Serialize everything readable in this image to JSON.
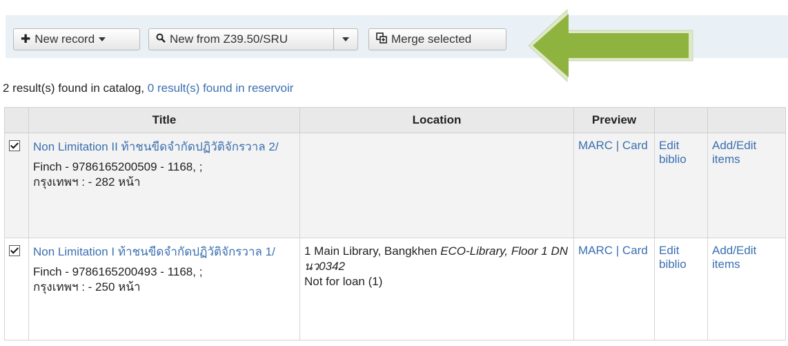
{
  "toolbar": {
    "new_record_label": "New record",
    "new_record_icon": "plus-icon",
    "z3950_label": "New from Z39.50/SRU",
    "z3950_icon": "search-icon",
    "merge_label": "Merge selected",
    "merge_icon": "merge-icon",
    "strip_color": "#e9f1f6",
    "arrow_color": "#8fb33f"
  },
  "summary": {
    "catalog_text": "2 result(s) found in catalog, ",
    "reservoir_link": "0 result(s) found in reservoir"
  },
  "table": {
    "headers": [
      "",
      "Title",
      "Location",
      "Preview",
      "",
      ""
    ],
    "rows": [
      {
        "checked": true,
        "title": "Non Limitation II ท้าชนขีดจำกัดปฏิวัติจักรวาล 2/",
        "meta_line1": "Finch - 9786165200509 - 1168, ;",
        "meta_line2": "กรุงเทพฯ : - 282 หน้า",
        "location_main": "",
        "location_italic": "",
        "location_status": "",
        "preview": "MARC | Card",
        "edit": "Edit biblio",
        "items": "Add/Edit items"
      },
      {
        "checked": true,
        "title": "Non Limitation I ท้าชนขีดจำกัดปฏิวัติจักรวาล 1/",
        "meta_line1": "Finch - 9786165200493 - 1168, ;",
        "meta_line2": "กรุงเทพฯ : - 250 หน้า",
        "location_main": "1 Main Library, Bangkhen ",
        "location_italic": "ECO-Library, Floor 1 DN นว0342",
        "location_status": "Not for loan (1)",
        "preview": "MARC | Card",
        "edit": "Edit biblio",
        "items": "Add/Edit items"
      }
    ]
  }
}
